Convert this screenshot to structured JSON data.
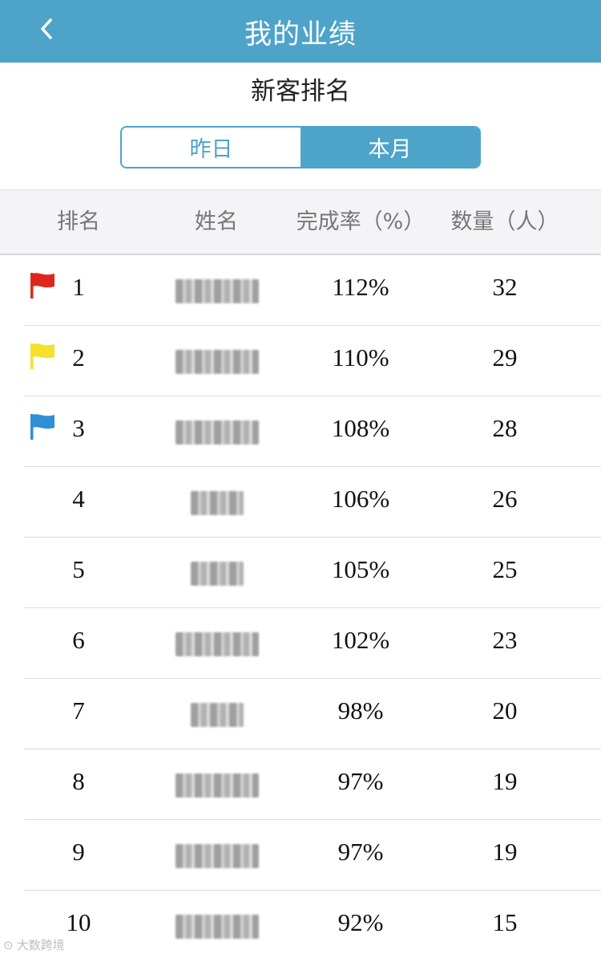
{
  "navbar": {
    "title": "我的业绩",
    "back_icon": "chevron-left-icon"
  },
  "section": {
    "title": "新客排名"
  },
  "tabs": [
    {
      "label": "昨日",
      "active": false
    },
    {
      "label": "本月",
      "active": true
    }
  ],
  "table": {
    "headers": {
      "rank": "排名",
      "name": "姓名",
      "rate": "完成率（%）",
      "count": "数量（人）"
    },
    "rows": [
      {
        "rank": "1",
        "flag": "red",
        "rate": "112%",
        "count": "32"
      },
      {
        "rank": "2",
        "flag": "yellow",
        "rate": "110%",
        "count": "29"
      },
      {
        "rank": "3",
        "flag": "blue",
        "rate": "108%",
        "count": "28"
      },
      {
        "rank": "4",
        "flag": null,
        "rate": "106%",
        "count": "26"
      },
      {
        "rank": "5",
        "flag": null,
        "rate": "105%",
        "count": "25"
      },
      {
        "rank": "6",
        "flag": null,
        "rate": "102%",
        "count": "23"
      },
      {
        "rank": "7",
        "flag": null,
        "rate": "98%",
        "count": "20"
      },
      {
        "rank": "8",
        "flag": null,
        "rate": "97%",
        "count": "19"
      },
      {
        "rank": "9",
        "flag": null,
        "rate": "97%",
        "count": "19"
      },
      {
        "rank": "10",
        "flag": null,
        "rate": "92%",
        "count": "15"
      }
    ]
  },
  "colors": {
    "primary": "#4ea3c9",
    "flag_red": "#e0261b",
    "flag_yellow": "#f5e12a",
    "flag_blue": "#2e8fd6"
  },
  "watermark": {
    "text": "大数跨境"
  }
}
